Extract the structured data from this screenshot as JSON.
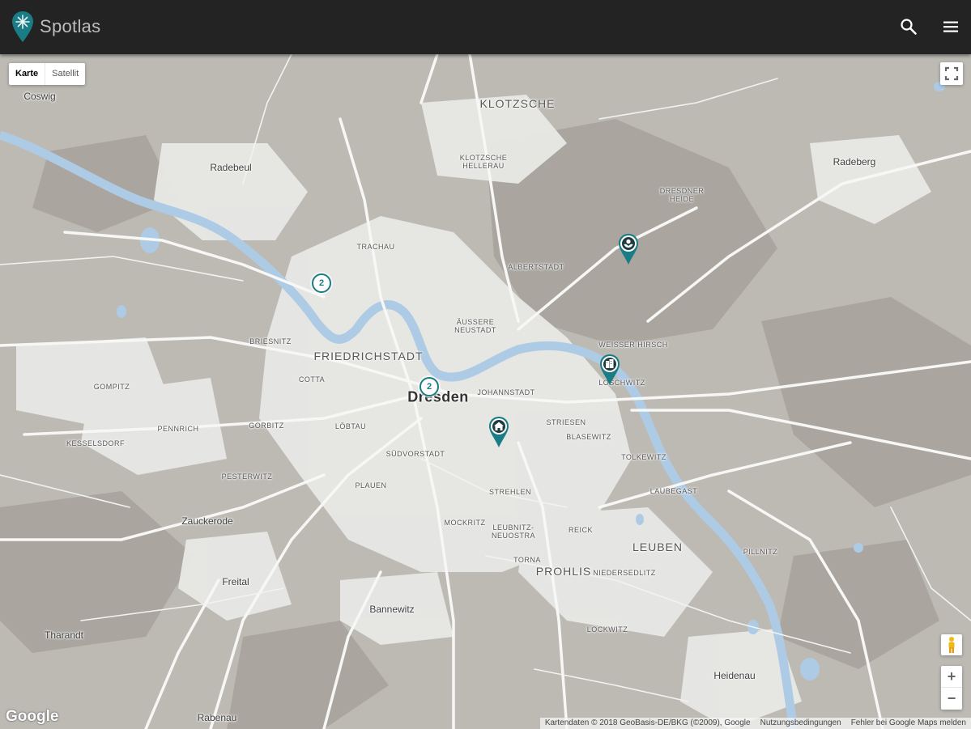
{
  "app": {
    "name": "Spotlas"
  },
  "header": {
    "search_icon": "search-icon",
    "menu_icon": "menu-icon"
  },
  "map_controls": {
    "map_type": {
      "options": [
        "Karte",
        "Satellit"
      ],
      "selected": "Karte"
    },
    "zoom_in": "+",
    "zoom_out": "−"
  },
  "map_labels": {
    "coswig": "Coswig",
    "radebeul": "Radebeul",
    "radeberg": "Radeberg",
    "klotzsche": "KLOTZSCHE",
    "klotzsche_hellerau": "KLOTZSCHE\nHELLERAU",
    "dresdner_heide": "DRESDNER\nHEIDE",
    "trachau": "TRACHAU",
    "albertstadt": "ALBERTSTADT",
    "aeussere_neustadt": "ÄUSSERE\nNEUSTADT",
    "briesnitz": "BRIESNITZ",
    "friedrichstadt": "FRIEDRICHSTADT",
    "weisser_hirsch": "WEISSER HIRSCH",
    "cotta": "COTTA",
    "dresden": "Dresden",
    "johannstadt": "JOHANNSTADT",
    "loschwitz": "LOSCHWITZ",
    "gompitz": "GOMPITZ",
    "pennrich": "PENNRICH",
    "gorbitz": "GORBITZ",
    "loebtau": "LÖBTAU",
    "striesen": "STRIESEN",
    "blasewitz": "BLASEWITZ",
    "kesselsdorf": "KESSELSDORF",
    "suedvorstadt": "SÜDVORSTADT",
    "tolkewitz": "TOLKEWITZ",
    "pesterwitz": "PESTERWITZ",
    "plauen": "PLAUEN",
    "strehlen": "STREHLEN",
    "laubegast": "LAUBEGAST",
    "zauckerode": "Zauckerode",
    "mockritz": "MOCKRITZ",
    "leubnitz_neuostra": "LEUBNITZ-\nNEUOSTRA",
    "reick": "REICK",
    "leuben": "LEUBEN",
    "pillnitz": "PILLNITZ",
    "torna": "TORNA",
    "prohlis": "PROHLIS",
    "niedersedlitz": "NIEDERSEDLITZ",
    "freital": "Freital",
    "bannewitz": "Bannewitz",
    "lockwitz": "LOCKWITZ",
    "tharandt": "Tharandt",
    "heidenau": "Heidenau",
    "rabenau": "Rabenau"
  },
  "markers": {
    "clusters": [
      {
        "count": "2"
      },
      {
        "count": "2"
      }
    ],
    "pins": [
      {
        "type": "flower-icon"
      },
      {
        "type": "building-icon"
      },
      {
        "type": "home-icon"
      }
    ]
  },
  "footer": {
    "google_logo": "Google",
    "map_data": "Kartendaten © 2018 GeoBasis-DE/BKG (©2009), Google",
    "terms": "Nutzungsbedingungen",
    "report": "Fehler bei Google Maps melden"
  },
  "colors": {
    "accent": "#1a7d85",
    "header_bg": "#232323",
    "land": "#bdbab4",
    "urban": "#e8e8e6",
    "water": "#aecbe6",
    "forest": "#a9a59e"
  }
}
